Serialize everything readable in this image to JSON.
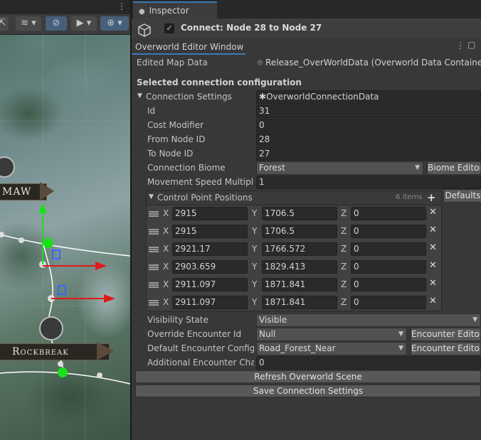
{
  "scene": {
    "labels": {
      "maw": "MAW",
      "rockbreak": "Rockbreak"
    },
    "toolbar_icons": [
      "move-icon",
      "layers-icon",
      "visibility-icon",
      "camera-icon",
      "gizmo-icon"
    ]
  },
  "inspector": {
    "tab_label": "Inspector",
    "object_name": "Connect: Node 28 to Node 27",
    "object_enabled": true
  },
  "editor": {
    "window_title": "Overworld Editor Window",
    "edited_map_label": "Edited Map Data",
    "edited_map_value": "Release_OverWorldData (Overworld Data Container)",
    "section_title": "Selected connection configuration",
    "settings_label": "Connection Settings",
    "settings_value": "OverworldConnectionData",
    "fields": {
      "id_label": "Id",
      "id_value": "31",
      "cost_label": "Cost Modifier",
      "cost_value": "0",
      "from_label": "From Node ID",
      "from_value": "28",
      "to_label": "To Node ID",
      "to_value": "27",
      "biome_label": "Connection Biome",
      "biome_value": "Forest",
      "biome_button": "Biome Editor",
      "speed_label": "Movement Speed Multiplier",
      "speed_value": "1"
    },
    "control_points": {
      "label": "Control Point Positions",
      "count": "6 items",
      "defaults_button": "Defaults",
      "axis_x": "X",
      "axis_y": "Y",
      "axis_z": "Z",
      "items": [
        {
          "x": "2915",
          "y": "1706.5",
          "z": "0"
        },
        {
          "x": "2915",
          "y": "1706.5",
          "z": "0"
        },
        {
          "x": "2921.17",
          "y": "1766.572",
          "z": "0"
        },
        {
          "x": "2903.659",
          "y": "1829.413",
          "z": "0"
        },
        {
          "x": "2911.097",
          "y": "1871.841",
          "z": "0"
        },
        {
          "x": "2911.097",
          "y": "1871.841",
          "z": "0"
        }
      ]
    },
    "visibility_label": "Visibility State",
    "visibility_value": "Visible",
    "override_label": "Override Encounter Id",
    "override_value": "Null",
    "override_button": "Encounter Editor",
    "default_enc_label": "Default Encounter Configuration",
    "default_enc_value": "Road_Forest_Near",
    "default_enc_button": "Encounter Editor",
    "additional_label": "Additional Encounter Chance",
    "additional_value": "0",
    "refresh_button": "Refresh Overworld Scene",
    "save_button": "Save Connection Settings"
  },
  "colors": {
    "accent": "#3a79bb",
    "panel_bg": "#383838",
    "field_bg": "#2a2a2a",
    "gizmo_green": "#19e019",
    "gizmo_red": "#e01919"
  }
}
